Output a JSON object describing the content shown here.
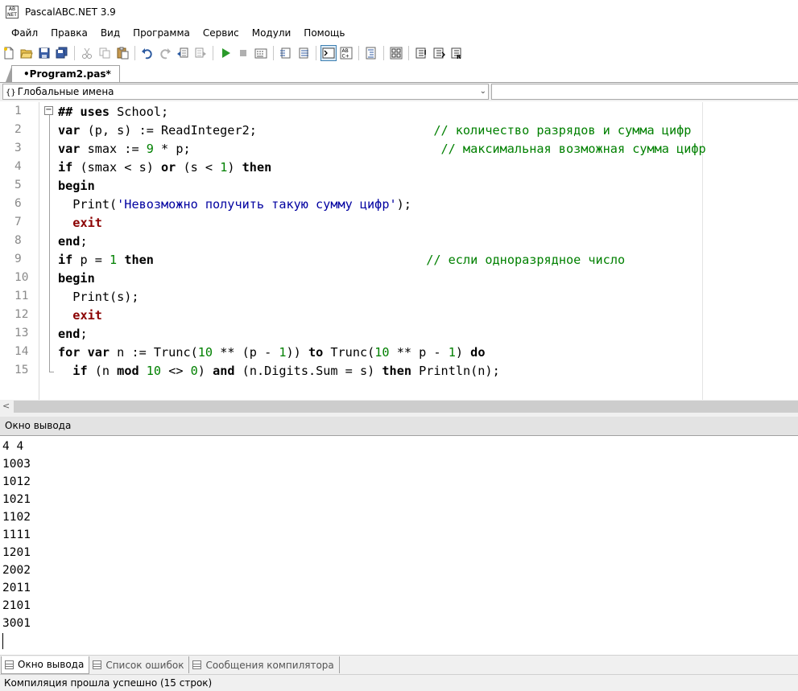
{
  "window": {
    "title": "PascalABC.NET 3.9",
    "icon_label": "AB NET"
  },
  "menu": [
    "Файл",
    "Правка",
    "Вид",
    "Программа",
    "Сервис",
    "Модули",
    "Помощь"
  ],
  "toolbar": {
    "groups": [
      [
        "new-file-icon",
        "open-file-icon",
        "save-icon",
        "save-all-icon"
      ],
      [
        "cut-icon",
        "copy-icon",
        "paste-icon"
      ],
      [
        "undo-icon",
        "redo-icon",
        "back-icon",
        "forward-icon"
      ],
      [
        "run-icon",
        "stop-icon",
        "debug-window-icon"
      ],
      [
        "comment-icon",
        "uncomment-icon"
      ],
      [
        "console-icon",
        "abc-icon"
      ],
      [
        "format-icon"
      ],
      [
        "code-blocks-icon"
      ],
      [
        "step-into-icon",
        "step-over-icon",
        "step-out-icon"
      ]
    ],
    "active": "console-icon"
  },
  "editor_tab": {
    "label": "•Program2.pas*"
  },
  "nav": {
    "left_icon": "{}",
    "left_value": "Глобальные имена",
    "right_value": ""
  },
  "code": {
    "line_numbers": [
      "1",
      "2",
      "3",
      "4",
      "5",
      "6",
      "7",
      "8",
      "9",
      "10",
      "11",
      "12",
      "13",
      "14",
      "15"
    ],
    "lines": [
      [
        {
          "t": "## ",
          "c": "kw"
        },
        {
          "t": "uses",
          "c": "kw"
        },
        {
          "t": " School;",
          "c": ""
        }
      ],
      [
        {
          "t": "var",
          "c": "kw"
        },
        {
          "t": " (p, s) := ReadInteger2;                        ",
          "c": ""
        },
        {
          "t": "// количество разрядов и сумма цифр",
          "c": "cmt"
        }
      ],
      [
        {
          "t": "var",
          "c": "kw"
        },
        {
          "t": " smax := ",
          "c": ""
        },
        {
          "t": "9",
          "c": "num"
        },
        {
          "t": " * p;                                  ",
          "c": ""
        },
        {
          "t": "// максимальная возможная сумма цифр",
          "c": "cmt"
        }
      ],
      [
        {
          "t": "if",
          "c": "kw"
        },
        {
          "t": " (smax < s) ",
          "c": ""
        },
        {
          "t": "or",
          "c": "kw"
        },
        {
          "t": " (s < ",
          "c": ""
        },
        {
          "t": "1",
          "c": "num"
        },
        {
          "t": ") ",
          "c": ""
        },
        {
          "t": "then",
          "c": "kw"
        }
      ],
      [
        {
          "t": "begin",
          "c": "kw"
        }
      ],
      [
        {
          "t": "  Print(",
          "c": ""
        },
        {
          "t": "'Невозможно получить такую сумму цифр'",
          "c": "str"
        },
        {
          "t": ");",
          "c": ""
        }
      ],
      [
        {
          "t": "  ",
          "c": ""
        },
        {
          "t": "exit",
          "c": "kw-red"
        }
      ],
      [
        {
          "t": "end",
          "c": "kw"
        },
        {
          "t": ";",
          "c": ""
        }
      ],
      [
        {
          "t": "if",
          "c": "kw"
        },
        {
          "t": " p = ",
          "c": ""
        },
        {
          "t": "1",
          "c": "num"
        },
        {
          "t": " ",
          "c": ""
        },
        {
          "t": "then",
          "c": "kw"
        },
        {
          "t": "                                     ",
          "c": ""
        },
        {
          "t": "// если одноразрядное число",
          "c": "cmt"
        }
      ],
      [
        {
          "t": "begin",
          "c": "kw"
        }
      ],
      [
        {
          "t": "  Print(s);",
          "c": ""
        }
      ],
      [
        {
          "t": "  ",
          "c": ""
        },
        {
          "t": "exit",
          "c": "kw-red"
        }
      ],
      [
        {
          "t": "end",
          "c": "kw"
        },
        {
          "t": ";",
          "c": ""
        }
      ],
      [
        {
          "t": "for",
          "c": "kw"
        },
        {
          "t": " ",
          "c": ""
        },
        {
          "t": "var",
          "c": "kw"
        },
        {
          "t": " n := Trunc(",
          "c": ""
        },
        {
          "t": "10",
          "c": "num"
        },
        {
          "t": " ** (p - ",
          "c": ""
        },
        {
          "t": "1",
          "c": "num"
        },
        {
          "t": ")) ",
          "c": ""
        },
        {
          "t": "to",
          "c": "kw"
        },
        {
          "t": " Trunc(",
          "c": ""
        },
        {
          "t": "10",
          "c": "num"
        },
        {
          "t": " ** p - ",
          "c": ""
        },
        {
          "t": "1",
          "c": "num"
        },
        {
          "t": ") ",
          "c": ""
        },
        {
          "t": "do",
          "c": "kw"
        }
      ],
      [
        {
          "t": "  ",
          "c": ""
        },
        {
          "t": "if",
          "c": "kw"
        },
        {
          "t": " (n ",
          "c": ""
        },
        {
          "t": "mod",
          "c": "kw"
        },
        {
          "t": " ",
          "c": ""
        },
        {
          "t": "10",
          "c": "num"
        },
        {
          "t": " <> ",
          "c": ""
        },
        {
          "t": "0",
          "c": "num"
        },
        {
          "t": ") ",
          "c": ""
        },
        {
          "t": "and",
          "c": "kw"
        },
        {
          "t": " (n.Digits.Sum = s) ",
          "c": ""
        },
        {
          "t": "then",
          "c": "kw"
        },
        {
          "t": " Println(n);",
          "c": ""
        }
      ]
    ]
  },
  "output_panel": {
    "title": "Окно вывода",
    "lines": [
      "4 4",
      "1003",
      "1012",
      "1021",
      "1102",
      "1111",
      "1201",
      "2002",
      "2011",
      "2101",
      "3001"
    ]
  },
  "bottom_tabs": [
    {
      "label": "Окно вывода",
      "active": true
    },
    {
      "label": "Список ошибок",
      "active": false
    },
    {
      "label": "Сообщения компилятора",
      "active": false
    }
  ],
  "status": {
    "text": "Компиляция прошла успешно (15 строк)"
  }
}
